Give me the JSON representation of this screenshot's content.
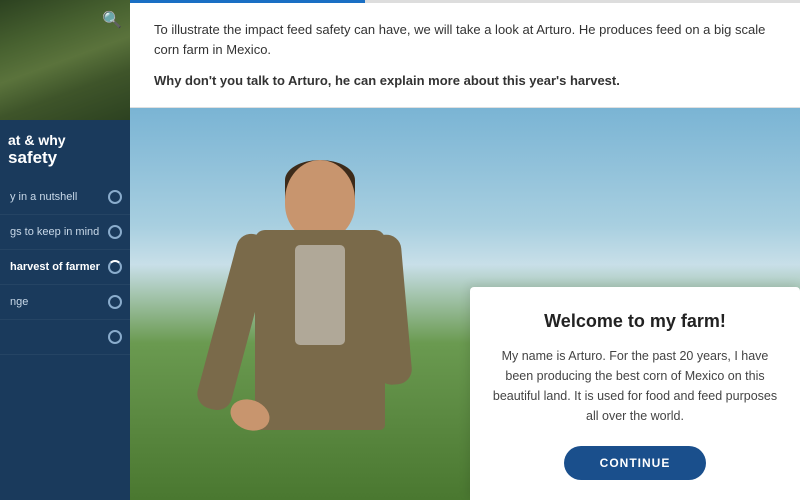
{
  "sidebar": {
    "title_line1": "at & why",
    "title_line2": "safety",
    "nav_items": [
      {
        "id": "item-1",
        "label": "y in a nutshell",
        "state": "incomplete"
      },
      {
        "id": "item-2",
        "label": "gs to keep in mind",
        "state": "incomplete"
      },
      {
        "id": "item-3",
        "label": "harvest of farmer",
        "state": "active"
      },
      {
        "id": "item-4",
        "label": "nge",
        "state": "incomplete"
      },
      {
        "id": "item-5",
        "label": "",
        "state": "incomplete"
      }
    ]
  },
  "main": {
    "top_text_body": "To illustrate the impact feed safety can have, we will take a look at Arturo. He produces feed on a big scale corn farm in Mexico.",
    "top_text_question": "Why don't you talk to Arturo, he can explain more about this year's harvest.",
    "dialog": {
      "title": "Welcome to my farm!",
      "body": "My name is Arturo. For the past 20 years, I have been producing the best corn of Mexico on this beautiful land. It is used for food and feed purposes all over the world.",
      "continue_button_label": "CONTINUE"
    },
    "progress_percent": 35
  }
}
